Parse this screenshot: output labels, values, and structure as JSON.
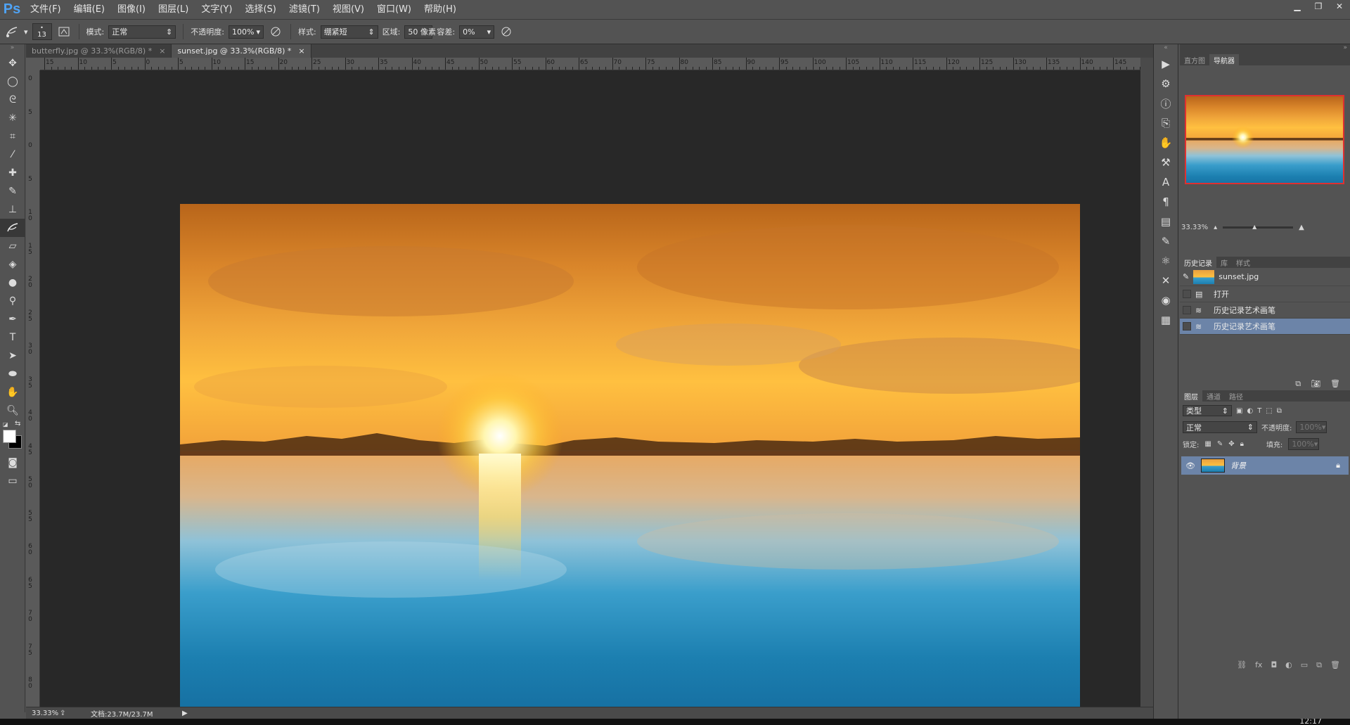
{
  "app": {
    "logo": "Ps"
  },
  "menu": [
    "文件(F)",
    "编辑(E)",
    "图像(I)",
    "图层(L)",
    "文字(Y)",
    "选择(S)",
    "滤镜(T)",
    "视图(V)",
    "窗口(W)",
    "帮助(H)"
  ],
  "window_controls": {
    "minimize": "▁",
    "restore": "❐",
    "close": "✕"
  },
  "options": {
    "brush_size": "13",
    "mode_label": "模式:",
    "mode_value": "正常",
    "opacity_label": "不透明度:",
    "opacity_value": "100%",
    "style_label": "样式:",
    "style_value": "绷紧短",
    "area_label": "区域:",
    "area_value": "50 像素",
    "tolerance_label": "容差:",
    "tolerance_value": "0%"
  },
  "tabs": [
    {
      "label": "butterfly.jpg @ 33.3%(RGB/8) *",
      "close": "×",
      "active": false
    },
    {
      "label": "sunset.jpg @ 33.3%(RGB/8) *",
      "close": "×",
      "active": true
    }
  ],
  "ruler": {
    "top": [
      "15",
      "10",
      "5",
      "0",
      "5",
      "10",
      "15",
      "20",
      "25",
      "30",
      "35",
      "40",
      "45",
      "50",
      "55",
      "60",
      "65",
      "70",
      "75",
      "80",
      "85",
      "90",
      "95",
      "100",
      "105",
      "110",
      "115",
      "120",
      "125",
      "130",
      "135",
      "140",
      "145"
    ],
    "left": [
      "0",
      "5",
      "0",
      "5",
      "1 0",
      "1 5",
      "2 0",
      "2 5",
      "3 0",
      "3 5",
      "4 0",
      "4 5",
      "5 0",
      "5 5",
      "6 0",
      "6 5",
      "7 0",
      "7 5",
      "8 0"
    ]
  },
  "status": {
    "zoom": "33.33%",
    "doc": "文档:23.7M/23.7M"
  },
  "navigator": {
    "tabs": [
      "直方图",
      "导航器"
    ],
    "active": 1,
    "zoom": "33.33%"
  },
  "history": {
    "tabs": [
      "历史记录",
      "库",
      "样式"
    ],
    "active": 0,
    "snapshot": "sunset.jpg",
    "items": [
      {
        "label": "打开",
        "icon": "document-icon",
        "selected": false
      },
      {
        "label": "历史记录艺术画笔",
        "icon": "art-history-brush-icon",
        "selected": false
      },
      {
        "label": "历史记录艺术画笔",
        "icon": "art-history-brush-icon",
        "selected": true
      }
    ]
  },
  "layers": {
    "tabs": [
      "图层",
      "通道",
      "路径"
    ],
    "active": 0,
    "filter_kind": "类型",
    "blend_mode": "正常",
    "opacity_label": "不透明度:",
    "opacity_value": "100%",
    "lock_label": "锁定:",
    "fill_label": "填充:",
    "fill_value": "100%",
    "layer_name": "背景"
  },
  "clock": "12:17",
  "colors": {
    "accent": "#6c84a8",
    "nav_frame": "#e03030",
    "logo": "#4fa3f5"
  }
}
